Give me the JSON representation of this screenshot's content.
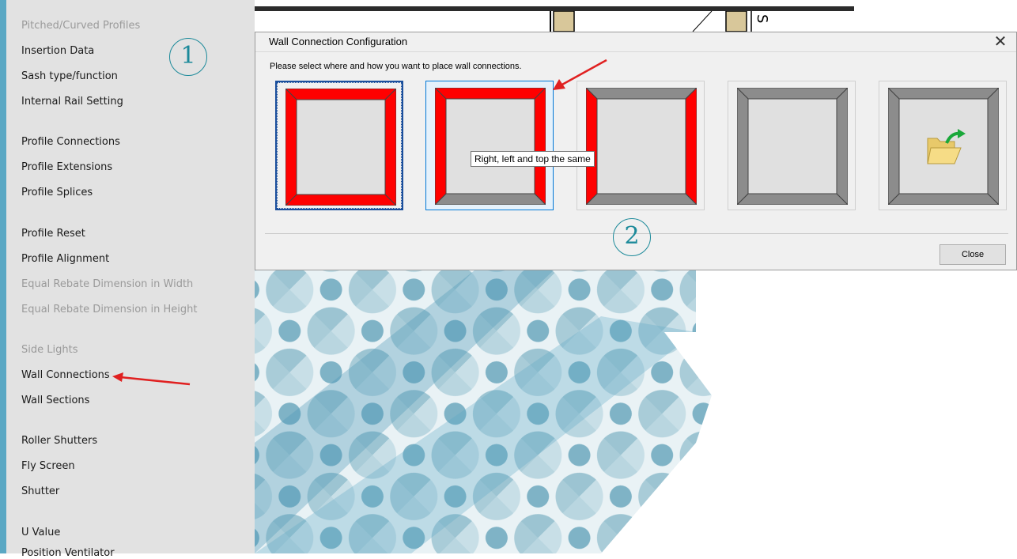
{
  "menu": {
    "items": [
      {
        "label": "Pitched/Curved Profiles",
        "enabled": false
      },
      {
        "label": "Insertion Data",
        "enabled": true
      },
      {
        "label": "Sash type/function",
        "enabled": true
      },
      {
        "label": "Internal Rail Setting",
        "enabled": true
      },
      {
        "label": "Profile Connections",
        "enabled": true
      },
      {
        "label": "Profile Extensions",
        "enabled": true
      },
      {
        "label": "Profile Splices",
        "enabled": true
      },
      {
        "label": "Profile Reset",
        "enabled": true
      },
      {
        "label": "Profile Alignment",
        "enabled": true
      },
      {
        "label": "Equal Rebate Dimension in Width",
        "enabled": false
      },
      {
        "label": "Equal Rebate Dimension in Height",
        "enabled": false
      },
      {
        "label": "Side Lights",
        "enabled": false
      },
      {
        "label": "Wall Connections",
        "enabled": true
      },
      {
        "label": "Wall Sections",
        "enabled": true
      },
      {
        "label": "Roller Shutters",
        "enabled": true
      },
      {
        "label": "Fly Screen",
        "enabled": true
      },
      {
        "label": "Shutter",
        "enabled": true
      },
      {
        "label": "U Value",
        "enabled": true
      },
      {
        "label": "Position Ventilator",
        "enabled": true
      }
    ]
  },
  "callouts": {
    "one": "1",
    "two": "2"
  },
  "dialog": {
    "title": "Wall Connection Configuration",
    "close_glyph": "✕",
    "instruction": "Please select where and how you want to place wall connections.",
    "tooltip": "Right, left and top the same",
    "close_button": "Close",
    "options": [
      {
        "name": "all-sides-same",
        "icon": "frame-all-red-icon",
        "state": "selected"
      },
      {
        "name": "right-left-top-same",
        "icon": "frame-right-left-top-red-icon",
        "state": "hover"
      },
      {
        "name": "right-left-same",
        "icon": "frame-right-left-red-icon",
        "state": "normal"
      },
      {
        "name": "none",
        "icon": "frame-gray-icon",
        "state": "normal"
      },
      {
        "name": "load-from-file",
        "icon": "open-folder-icon",
        "state": "normal"
      }
    ]
  },
  "colors": {
    "accent_red": "#ff0000",
    "frame_gray": "#8c8c8c",
    "callout_teal": "#1c8a9a",
    "selection_blue": "#0078d7"
  }
}
